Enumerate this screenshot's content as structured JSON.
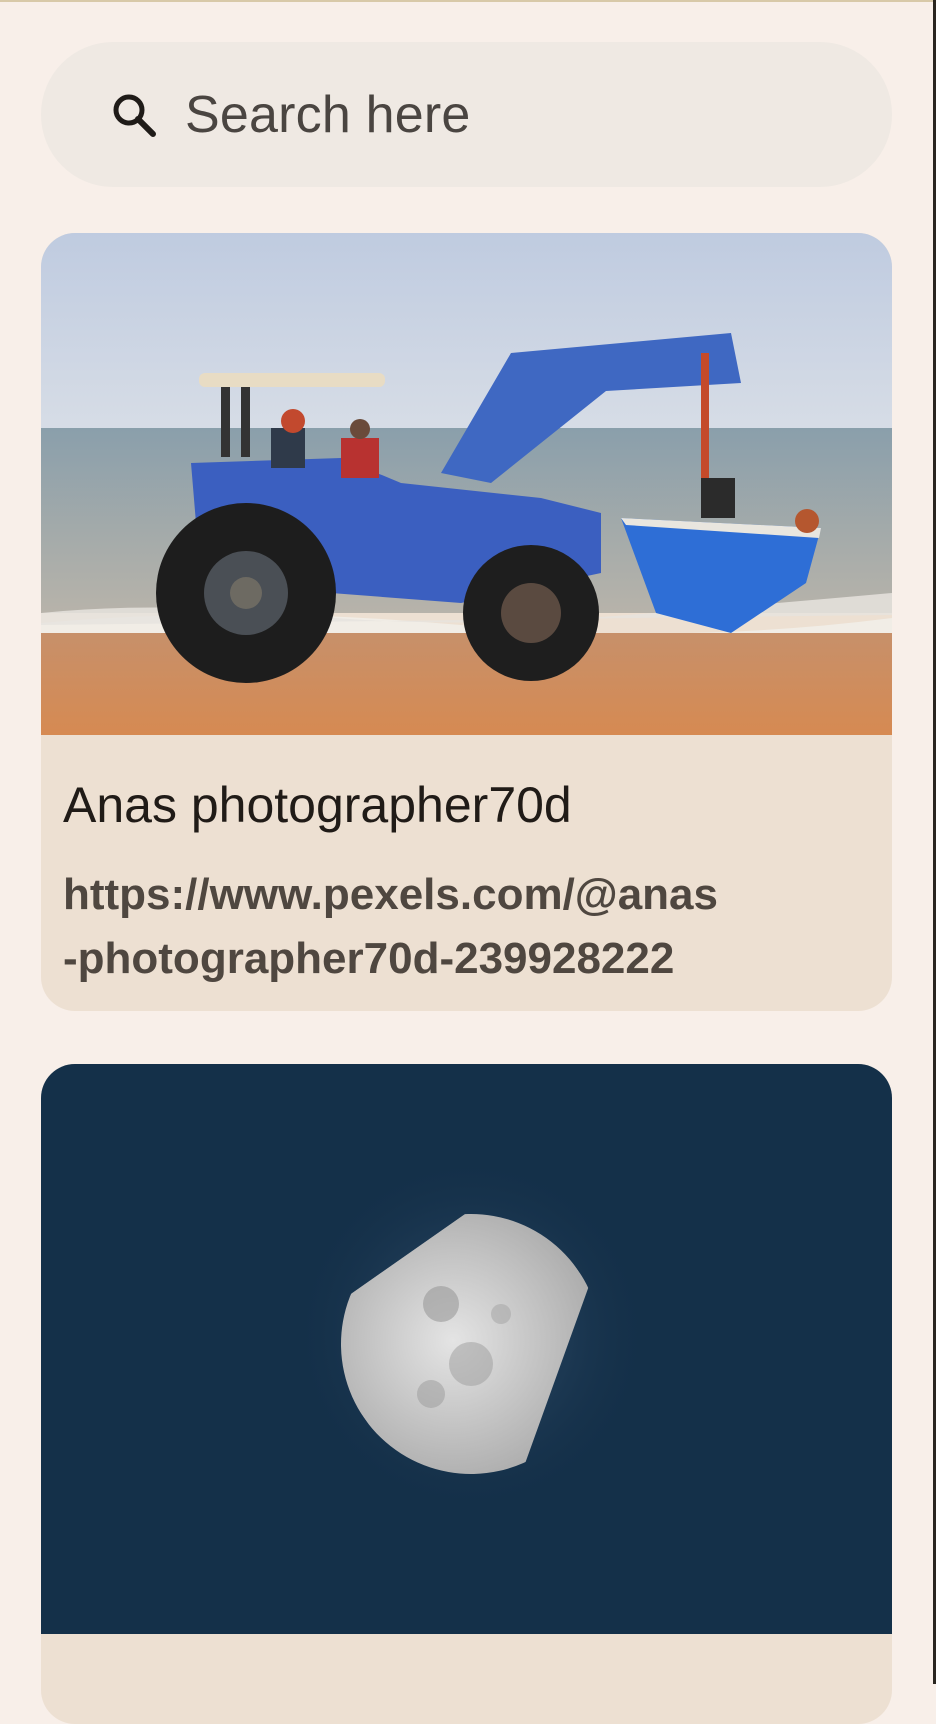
{
  "search": {
    "placeholder": "Search here",
    "icon": "search-icon"
  },
  "results": [
    {
      "photo": "tractor-boat-beach-photo",
      "title": "Anas photographer70d",
      "url_line1": "https://www.pexels.com/@anas",
      "url_line2": "-photographer70d-239928222"
    },
    {
      "photo": "half-moon-photo"
    }
  ],
  "colors": {
    "background": "#f8efe9",
    "search_bar": "#efe9e3",
    "card": "#ede0d2"
  }
}
